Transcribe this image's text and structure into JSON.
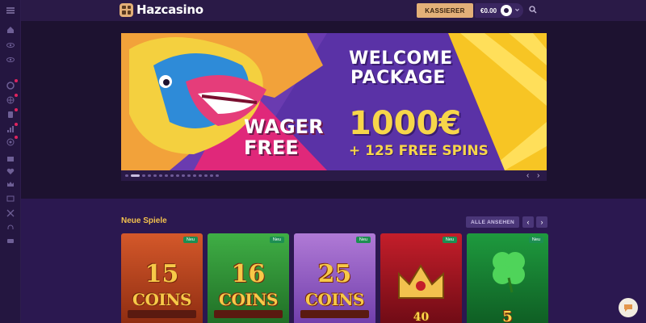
{
  "brand": {
    "logo_text": "Hazcasino"
  },
  "header": {
    "cashier_label": "KASSIERER",
    "balance": "€0.00"
  },
  "hero": {
    "left_line1": "WAGER",
    "left_line2": "FREE",
    "headline_line1": "WELCOME",
    "headline_line2": "PACKAGE",
    "amount": "1000€",
    "spins": "+ 125 FREE SPINS",
    "slide_count": 16,
    "active_slide": 2
  },
  "section": {
    "title": "Neue Spiele",
    "see_all_label": "ALLE ANSEHEN",
    "prev_label": "‹",
    "next_label": "›"
  },
  "games": [
    {
      "badge": "Neu",
      "number": "15",
      "coins": "COINS"
    },
    {
      "badge": "Neu",
      "number": "16",
      "coins": "COINS"
    },
    {
      "badge": "Neu",
      "number": "25",
      "coins": "COINS"
    },
    {
      "badge": "Neu",
      "number": "40"
    },
    {
      "badge": "Neu",
      "number": "5"
    }
  ],
  "colors": {
    "accent": "#e3b078",
    "section_title": "#f2c14e",
    "new_badge": "#1d8f52",
    "banner_purple": "#6a3bb0",
    "banner_pink": "#e0287a",
    "banner_yellow": "#f7d64a"
  },
  "icons": [
    "menu-icon",
    "home-icon",
    "eye-icon",
    "eye-icon",
    "chip-icon",
    "globe-icon",
    "cards-icon",
    "chart-icon",
    "target-icon",
    "gift-icon",
    "heart-icon",
    "crown-icon",
    "book-icon",
    "tools-icon",
    "headset-icon",
    "chat-icon"
  ]
}
